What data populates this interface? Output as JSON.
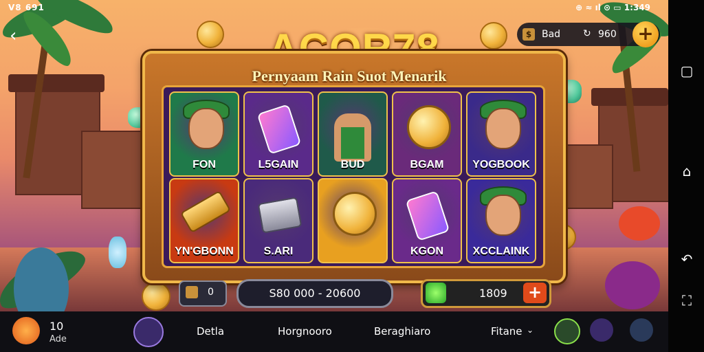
{
  "status_bar": {
    "left": "V8 691",
    "right": "⊕ ≈ ıl  ⊙ ▭ 1:349"
  },
  "balance": {
    "label": "Bad",
    "value": "960",
    "plus": "+"
  },
  "title": "ACOR78",
  "subtitle": "Pernyaam Rain Suot Menarik",
  "reels": [
    {
      "label": "FON",
      "icon": "leprechaun-icon",
      "bg": "#1f7a4a"
    },
    {
      "label": "L5GAIN",
      "icon": "ticket-icon",
      "bg": "#5a2a8a"
    },
    {
      "label": "BUD",
      "icon": "bodybuilder-icon",
      "bg": "#1f5a4a"
    },
    {
      "label": "BGAM",
      "icon": "coin-icon",
      "bg": "#6a2a7a"
    },
    {
      "label": "YOGBOOK",
      "icon": "leprechaun-icon",
      "bg": "#3a2a8a"
    },
    {
      "label": "YN'GBONN",
      "icon": "gold-bar-icon",
      "bg": "#c83a12"
    },
    {
      "label": "S.ARI",
      "icon": "wallet-icon",
      "bg": "#4a2a7a"
    },
    {
      "label": "",
      "icon": "q-symbol-icon",
      "bg": "#e8a020"
    },
    {
      "label": "KGON",
      "icon": "ticket-icon",
      "bg": "#6a2a8a"
    },
    {
      "label": "XCCLAINK",
      "icon": "leprechaun-icon",
      "bg": "#3a2a9a"
    }
  ],
  "controls": {
    "left_value": "0",
    "bet_range": "S80 000 - 20600",
    "spin_value": "1809",
    "plus": "+"
  },
  "bottom_bar": {
    "count": "10",
    "sub_label": "Ade",
    "links": [
      "Detla",
      "Horgnooro",
      "Beraghiaro",
      "Fitane"
    ]
  }
}
